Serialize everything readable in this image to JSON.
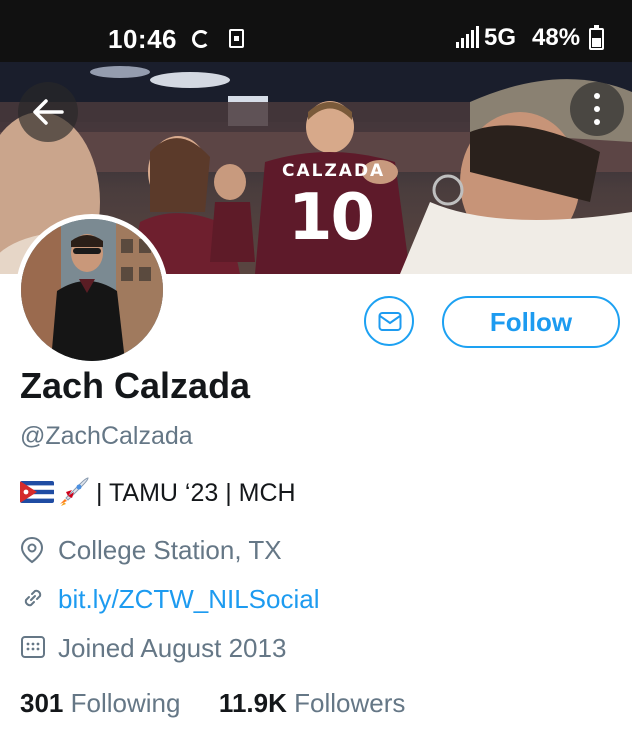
{
  "status_bar": {
    "time": "10:46",
    "network": "5G",
    "battery_percent": "48%",
    "battery_level": 0.48
  },
  "banner": {
    "jersey_name": "CALZADA",
    "jersey_number": "10"
  },
  "profile": {
    "display_name": "Zach Calzada",
    "handle": "@ZachCalzada",
    "bio": "| TAMU ‘23 | MCH",
    "location": "College Station, TX",
    "website": "bit.ly/ZCTW_NILSocial",
    "joined": "Joined August 2013",
    "following_count": "301",
    "following_label": "Following",
    "followers_count": "11.9K",
    "followers_label": "Followers"
  },
  "actions": {
    "follow_label": "Follow"
  },
  "icons": {
    "back": "arrow-left-icon",
    "more": "more-vertical-icon",
    "message": "envelope-icon",
    "location": "location-pin-icon",
    "link": "link-icon",
    "calendar": "calendar-icon",
    "bio_emojis": [
      "cuba-flag-icon",
      "rocket-icon"
    ]
  },
  "colors": {
    "accent": "#1d9bf0",
    "text_primary": "#14171a",
    "text_secondary": "#657786",
    "status_bar": "#111111"
  }
}
